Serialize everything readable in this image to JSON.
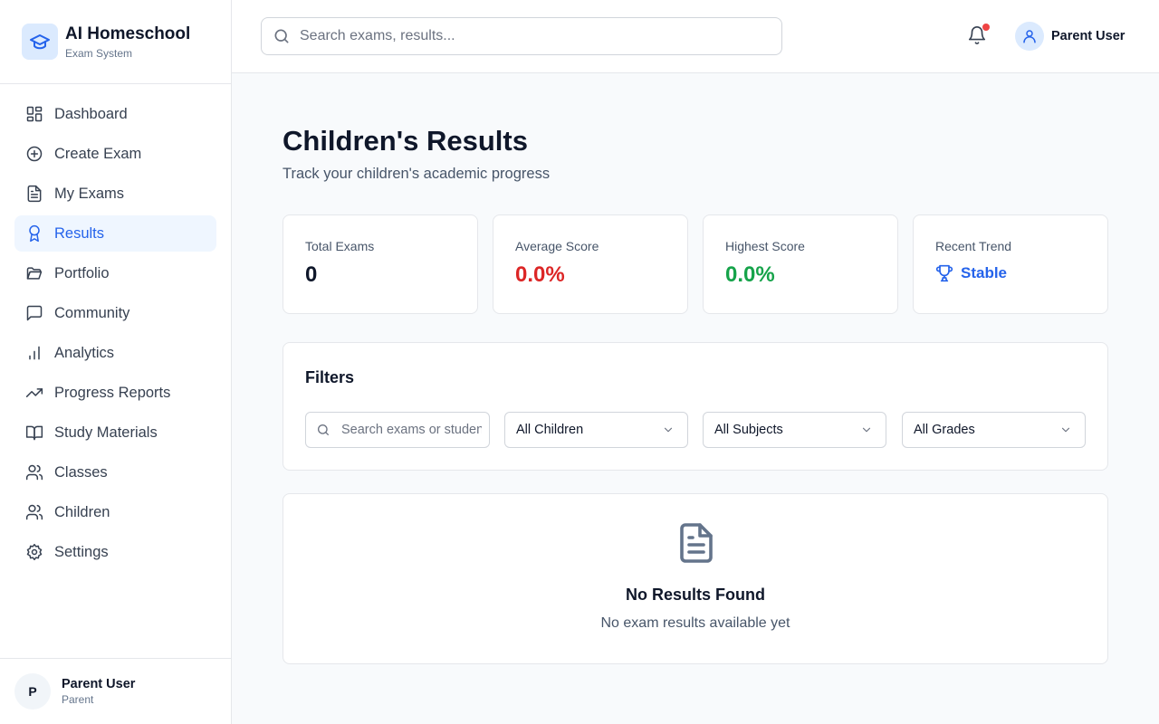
{
  "brand": {
    "title": "AI Homeschool",
    "subtitle": "Exam System"
  },
  "sidebar": {
    "items": [
      {
        "label": "Dashboard",
        "icon": "dashboard-icon"
      },
      {
        "label": "Create Exam",
        "icon": "plus-circle-icon"
      },
      {
        "label": "My Exams",
        "icon": "file-text-icon"
      },
      {
        "label": "Results",
        "icon": "award-icon",
        "active": true
      },
      {
        "label": "Portfolio",
        "icon": "folder-open-icon"
      },
      {
        "label": "Community",
        "icon": "message-square-icon"
      },
      {
        "label": "Analytics",
        "icon": "bar-chart-icon"
      },
      {
        "label": "Progress Reports",
        "icon": "trending-up-icon"
      },
      {
        "label": "Study Materials",
        "icon": "book-open-icon"
      },
      {
        "label": "Classes",
        "icon": "users-icon"
      },
      {
        "label": "Children",
        "icon": "users-icon"
      },
      {
        "label": "Settings",
        "icon": "gear-icon"
      }
    ],
    "user": {
      "initial": "P",
      "name": "Parent User",
      "role": "Parent"
    }
  },
  "header": {
    "search_placeholder": "Search exams, results...",
    "user_name": "Parent User",
    "has_notification": true
  },
  "page": {
    "title": "Children's Results",
    "subtitle": "Track your children's academic progress"
  },
  "stats": {
    "total_exams": {
      "label": "Total Exams",
      "value": "0"
    },
    "average_score": {
      "label": "Average Score",
      "value": "0.0%",
      "color": "#dc2626"
    },
    "highest_score": {
      "label": "Highest Score",
      "value": "0.0%",
      "color": "#16a34a"
    },
    "recent_trend": {
      "label": "Recent Trend",
      "value": "Stable",
      "icon": "trophy-icon",
      "color": "#2563eb"
    }
  },
  "filters": {
    "title": "Filters",
    "search_placeholder": "Search exams or students...",
    "children_select": "All Children",
    "subjects_select": "All Subjects",
    "grades_select": "All Grades"
  },
  "empty_state": {
    "icon": "file-text-icon",
    "title": "No Results Found",
    "message": "No exam results available yet"
  },
  "colors": {
    "accent": "#2563eb",
    "danger": "#dc2626",
    "success": "#16a34a",
    "notification": "#ef4444"
  }
}
